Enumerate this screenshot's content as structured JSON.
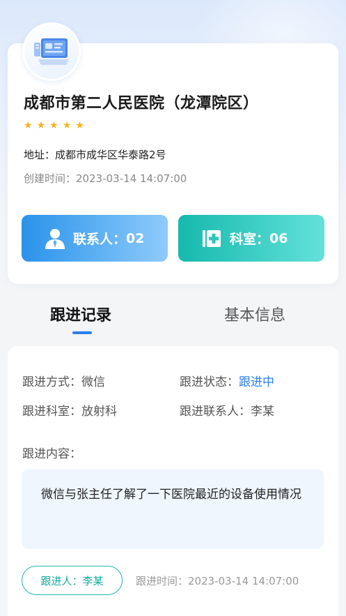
{
  "hospital": {
    "name": "成都市第二人民医院（龙潭院区）",
    "rating": 5,
    "address_label": "地址：",
    "address_value": "成都市成华区华泰路2号",
    "created_label": "创建时间：",
    "created_value": "2023-03-14 14:07:00",
    "logo_icon": "hospital-computer-icon"
  },
  "stats": {
    "contacts_label": "联系人：",
    "contacts_value": "02",
    "contacts_icon": "contact-person-icon",
    "depts_label": "科室：",
    "depts_value": "06",
    "depts_icon": "department-icon"
  },
  "tabs": [
    {
      "label": "跟进记录",
      "active": true
    },
    {
      "label": "基本信息",
      "active": false
    }
  ],
  "record": {
    "method_label": "跟进方式：",
    "method_value": "微信",
    "status_label": "跟进状态：",
    "status_value": "跟进中",
    "dept_label": "跟进科室：",
    "dept_value": "放射科",
    "contact_label": "跟进联系人：",
    "contact_value": "李某",
    "content_label": "跟进内容：",
    "content_value": "微信与张主任了解了一下医院最近的设备使用情况",
    "follower_label": "跟进人：",
    "follower_value": "李某",
    "time_label": "跟进时间：",
    "time_value": "2023-03-14 14:07:00"
  },
  "colors": {
    "accent_blue": "#2a7ff0",
    "star": "#f7b21b",
    "teal": "#16b9ad"
  }
}
